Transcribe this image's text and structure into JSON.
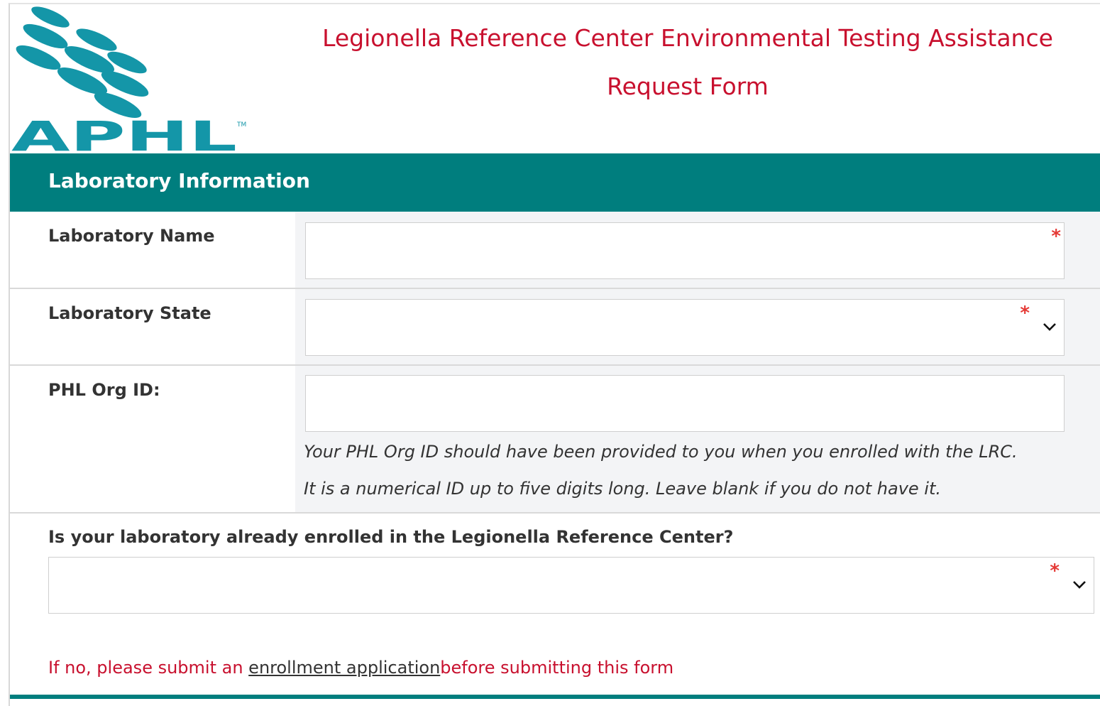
{
  "logo": {
    "text": "APHL",
    "trademark": "TM",
    "color": "#1496a8"
  },
  "header": {
    "title_line1": "Legionella Reference Center Environmental Testing Assistance",
    "title_line2": "Request Form",
    "title_color": "#c8102e"
  },
  "section": {
    "title": "Laboratory Information",
    "color": "#007e7e"
  },
  "fields": {
    "lab_name": {
      "label": "Laboratory Name",
      "value": "",
      "required": "*"
    },
    "lab_state": {
      "label": "Laboratory State",
      "value": "",
      "required": "*",
      "icon": "chevron-down-icon"
    },
    "phl_org_id": {
      "label": "PHL Org ID:",
      "value": "",
      "help_line1": "Your PHL Org ID should have been provided to you when you enrolled with the LRC.",
      "help_line2": "It is a numerical ID up to five digits long. Leave blank if you do not have it."
    },
    "enrolled": {
      "label": "Is your laboratory already enrolled in the Legionella Reference Center?",
      "value": "",
      "required": "*",
      "icon": "chevron-down-icon"
    }
  },
  "note": {
    "prefix": "If no, please submit an ",
    "link": "enrollment application",
    "suffix": "before submitting this form"
  }
}
